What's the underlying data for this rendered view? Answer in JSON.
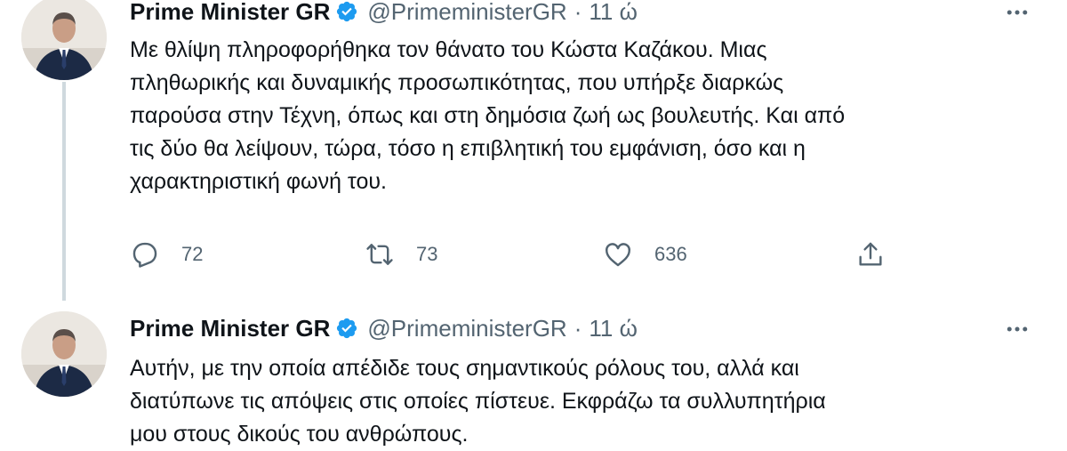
{
  "tweets": [
    {
      "author_name": "Prime Minister GR",
      "handle": "@PrimeministerGR",
      "separator": "·",
      "time": "11 ώ",
      "text_lines": [
        "Με θλίψη πληροφορήθηκα τον θάνατο του Κώστα Καζάκου. Μιας",
        "πληθωρικής και δυναμικής προσωπικότητας, που υπήρξε διαρκώς",
        "παρούσα στην Τέχνη, όπως και στη δημόσια ζωή ως βουλευτής. Και από",
        "τις δύο θα λείψουν, τώρα, τόσο η επιβλητική του εμφάνιση, όσο και η",
        "χαρακτηριστική φωνή του."
      ],
      "actions": {
        "replies": "72",
        "retweets": "73",
        "likes": "636"
      }
    },
    {
      "author_name": "Prime Minister GR",
      "handle": "@PrimeministerGR",
      "separator": "·",
      "time": "11 ώ",
      "text_lines": [
        "Αυτήν, με την οποία απέδιδε τους σημαντικούς ρόλους του, αλλά και",
        "διατύπωνε τις απόψεις στις οποίες πίστευε. Εκφράζω τα συλλυπητήρια",
        "μου στους δικούς του ανθρώπους."
      ]
    }
  ],
  "icons": {
    "verified": "verified-badge-icon",
    "more": "more-options-icon",
    "reply": "reply-icon",
    "retweet": "retweet-icon",
    "like": "heart-icon",
    "share": "share-icon"
  },
  "colors": {
    "verified_blue": "#1d9bf0",
    "secondary_text": "#536471",
    "thread_line": "#cfd9de"
  }
}
